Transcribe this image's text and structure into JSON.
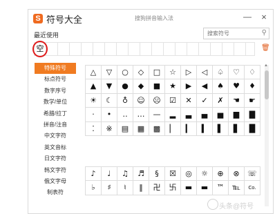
{
  "window": {
    "title": "符号大全",
    "logo_letter": "S",
    "subtitle": "搜狗拼音输入法",
    "minimize": "—",
    "close": "×"
  },
  "recent": {
    "label": "最近使用",
    "items": [
      "空"
    ],
    "delete_icon": "trash-icon"
  },
  "search": {
    "placeholder": "搜索符号",
    "icon": "search-icon"
  },
  "sidebar": {
    "items": [
      {
        "label": "特殊符号",
        "active": true
      },
      {
        "label": "标点符号"
      },
      {
        "label": "数字序号"
      },
      {
        "label": "数学/单位"
      },
      {
        "label": "希腊/拉丁"
      },
      {
        "label": "拼音/注音"
      },
      {
        "label": "中文字符"
      },
      {
        "label": "英文音标"
      },
      {
        "label": "日文字符"
      },
      {
        "label": "韩文字符"
      },
      {
        "label": "俄文字母"
      },
      {
        "label": "制表符"
      }
    ]
  },
  "symbols_top": [
    "△",
    "▽",
    "○",
    "◇",
    "□",
    "☆",
    "▷",
    "◁",
    "♤",
    "♡",
    "♢",
    "▲",
    "▼",
    "●",
    "◆",
    "■",
    "★",
    "▶",
    "◀",
    "♠",
    "♥",
    "♦",
    "☀",
    "☾",
    "♁",
    "☺",
    "☹",
    "☑",
    "✕",
    "✓",
    "✗",
    "☚",
    "☛",
    "·",
    "•",
    "‥",
    "…",
    "—",
    "▂",
    "▃",
    "▄",
    "▅",
    "▆",
    "▇",
    "⁚",
    "※",
    "▤",
    "▦",
    "▩",
    "▏",
    "▎",
    "▍",
    "▌",
    "▋",
    "█"
  ],
  "symbols_bottom": [
    "♪",
    "♩",
    "♫",
    "♬",
    "§",
    "☒",
    "◎",
    "☼",
    "⊕",
    "⊗",
    "☏",
    "♭",
    "♯",
    "♮",
    "‖",
    "卍",
    "卐",
    "▬",
    "▬",
    "™",
    "℡",
    "Co."
  ],
  "accent_color": "#f07b21",
  "watermark": "头条@符号"
}
